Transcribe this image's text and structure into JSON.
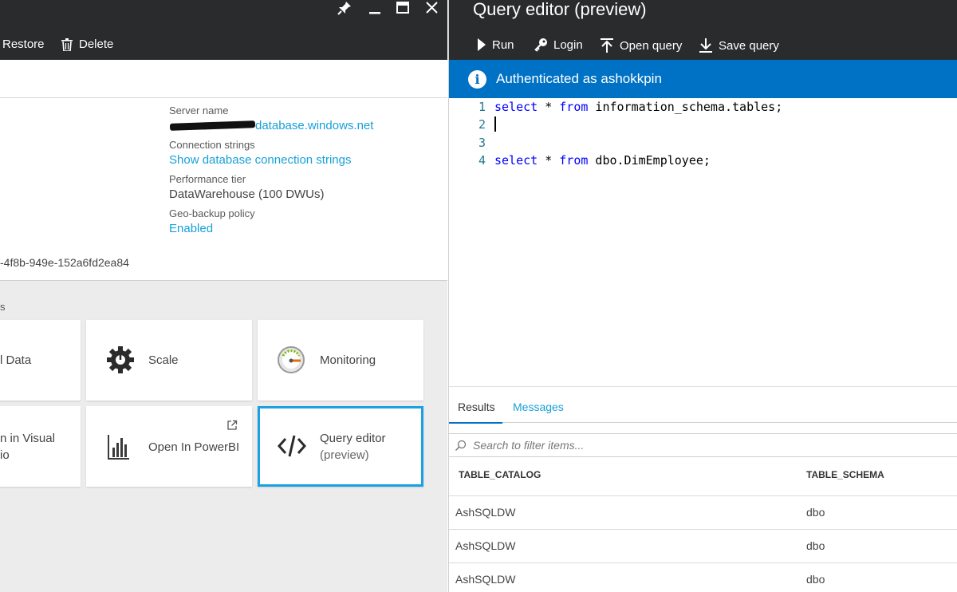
{
  "left_blade": {
    "commands": [
      {
        "label": "Restore",
        "icon": "restore-icon"
      },
      {
        "label": "Delete",
        "icon": "trash-icon"
      }
    ],
    "window_controls": [
      "pin-icon",
      "minimize-icon",
      "maximize-icon",
      "close-icon"
    ],
    "essentials": {
      "server_name_label": "Server name",
      "server_name_value": "database.windows.net",
      "connection_strings_label": "Connection strings",
      "connection_strings_link": "Show database connection strings",
      "performance_tier_label": "Performance tier",
      "performance_tier_value": "DataWarehouse (100 DWUs)",
      "geo_backup_label": "Geo-backup policy",
      "geo_backup_value": "Enabled",
      "subscription_id_fragment": "-4f8b-949e-152a6fd2ea84"
    },
    "section_label_fragment": "s",
    "tiles": [
      {
        "label": "l Data",
        "icon": ""
      },
      {
        "label": "Scale",
        "icon": "gear-icon"
      },
      {
        "label": "Monitoring",
        "icon": "gauge-icon"
      },
      {
        "label_line1": "n in Visual",
        "label_line2": "io",
        "icon": ""
      },
      {
        "label": "Open In PowerBI",
        "icon": "powerbi-icon",
        "badge": "external-link-icon"
      },
      {
        "label_line1": "Query editor",
        "label_line2": "(preview)",
        "icon": "code-icon"
      }
    ]
  },
  "right_blade": {
    "title": "Query editor (preview)",
    "commands": [
      {
        "label": "Run",
        "icon": "play-icon"
      },
      {
        "label": "Login",
        "icon": "key-icon"
      },
      {
        "label": "Open query",
        "icon": "upload-icon"
      },
      {
        "label": "Save query",
        "icon": "download-icon"
      }
    ],
    "info_message": "Authenticated as ashokkpin",
    "editor_lines": [
      {
        "num": "1",
        "kw1": "select",
        "mid": " * ",
        "kw2": "from",
        "rest": " information_schema.tables;"
      },
      {
        "num": "2",
        "kw1": "",
        "mid": "",
        "kw2": "",
        "rest": ""
      },
      {
        "num": "3",
        "kw1": "",
        "mid": "",
        "kw2": "",
        "rest": ""
      },
      {
        "num": "4",
        "kw1": "select",
        "mid": " * ",
        "kw2": "from",
        "rest": " dbo.DimEmployee;"
      }
    ],
    "results_tabs": [
      "Results",
      "Messages"
    ],
    "active_tab": "Results",
    "filter_placeholder": "Search to filter items...",
    "columns": [
      "TABLE_CATALOG",
      "TABLE_SCHEMA"
    ],
    "rows": [
      [
        "AshSQLDW",
        "dbo"
      ],
      [
        "AshSQLDW",
        "dbo"
      ],
      [
        "AshSQLDW",
        "dbo"
      ]
    ]
  },
  "colors": {
    "header_bg": "#2a2b2d",
    "info_bar_bg": "#0072c6",
    "link": "#16a1d8",
    "selected_tile_border": "#1ba1e2"
  }
}
